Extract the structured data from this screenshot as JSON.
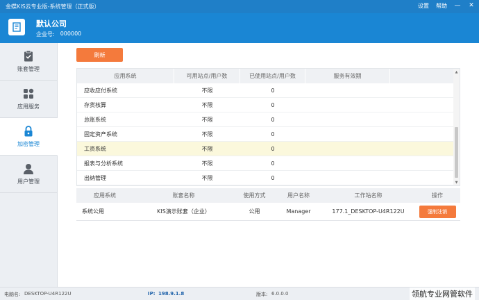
{
  "window": {
    "title": "金蝶KIS云专业版-系统管理（正式版）",
    "settings": "设置",
    "help": "帮助",
    "minimize": "—",
    "close": "✕"
  },
  "header": {
    "company_name": "默认公司",
    "company_no_label": "企业号:",
    "company_no": "000000"
  },
  "sidebar": {
    "items": [
      {
        "label": "账套管理",
        "icon": "clipboard-icon"
      },
      {
        "label": "应用服务",
        "icon": "apps-grid-icon"
      },
      {
        "label": "加密管理",
        "icon": "lock-icon"
      },
      {
        "label": "用户管理",
        "icon": "user-icon"
      }
    ],
    "active": "加密管理"
  },
  "toolbar": {
    "refresh": "刷新"
  },
  "license_table": {
    "headers": [
      "应用系统",
      "可用站点/用户数",
      "已使用站点/用户数",
      "服务有效期"
    ],
    "rows": [
      {
        "system": "应收应付系统",
        "available": "不限",
        "used": "0",
        "expiry": ""
      },
      {
        "system": "存货核算",
        "available": "不限",
        "used": "0",
        "expiry": ""
      },
      {
        "system": "总账系统",
        "available": "不限",
        "used": "0",
        "expiry": ""
      },
      {
        "system": "固定资产系统",
        "available": "不限",
        "used": "0",
        "expiry": ""
      },
      {
        "system": "工资系统",
        "available": "不限",
        "used": "0",
        "expiry": ""
      },
      {
        "system": "报表与分析系统",
        "available": "不限",
        "used": "0",
        "expiry": ""
      },
      {
        "system": "出纳管理",
        "available": "不限",
        "used": "0",
        "expiry": ""
      }
    ],
    "highlighted_row": 4
  },
  "session_table": {
    "headers": [
      "应用系统",
      "账套名称",
      "使用方式",
      "用户名称",
      "工作站名称",
      "操作"
    ],
    "rows": [
      {
        "system": "系统公用",
        "account": "KIS演示账套（企业）",
        "mode": "公用",
        "user": "Manager",
        "workstation": "177.1_DESKTOP-U4R122U",
        "action": "强制注销"
      }
    ]
  },
  "statusbar": {
    "computer_label": "电脑名:",
    "computer": "DESKTOP-U4R122U",
    "ip_label": "IP:",
    "ip": "198.9.1.8",
    "version_label": "版本:",
    "version": "6.0.0.0"
  },
  "watermark": "领航专业网管软件",
  "colors": {
    "titlebar": "#1f7fc8",
    "header": "#1a86d4",
    "accent_orange": "#f47a3c",
    "highlight_row": "#fbf8dc"
  }
}
